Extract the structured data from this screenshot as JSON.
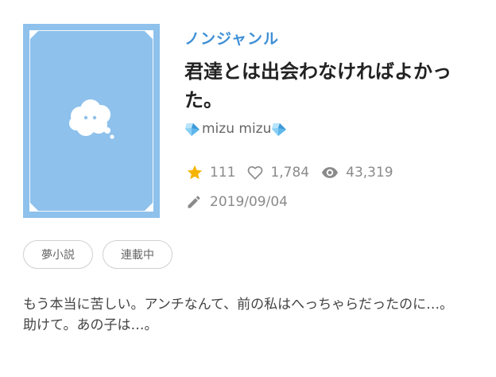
{
  "work": {
    "genre": "ノンジャンル",
    "title": "君達とは出会わなければよかった。",
    "author": "mizu mizu",
    "stars": "111",
    "likes": "1,784",
    "views": "43,319",
    "date": "2019/09/04",
    "tags": [
      "夢小説",
      "連載中"
    ],
    "description": [
      "もう本当に苦しい。アンチなんて、前の私はへっちゃらだったのに…。",
      "助けて。あの子は…。"
    ]
  },
  "colors": {
    "accent": "#3e8fd6",
    "cover_bg": "#8ec1ec",
    "star": "#f5b400",
    "muted": "#8a8a8a"
  },
  "icons": {
    "cover": "thought-cloud-icon",
    "author_badge": "diamond-icon",
    "stars": "star-icon",
    "likes": "heart-icon",
    "views": "eye-icon",
    "date": "pencil-icon"
  }
}
